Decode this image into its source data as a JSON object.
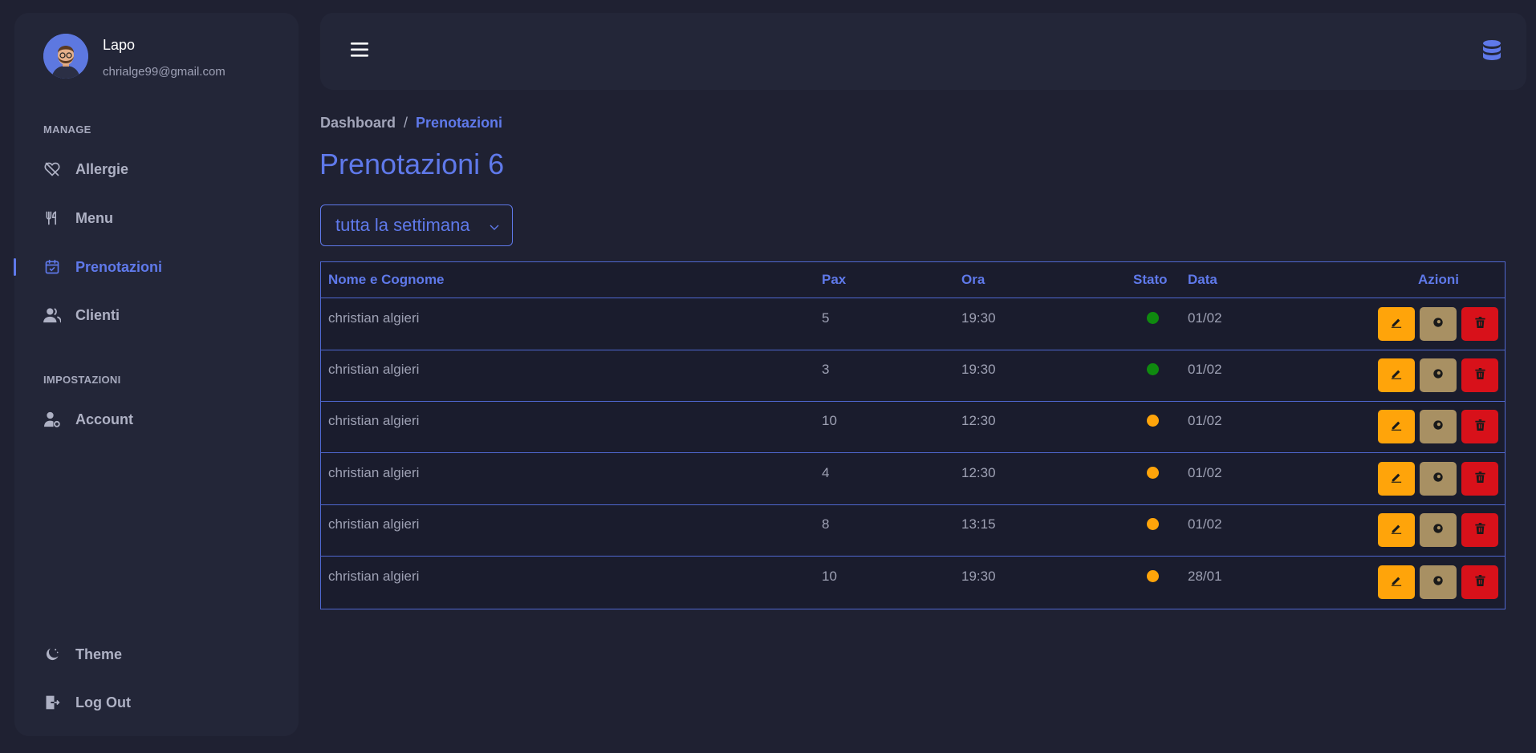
{
  "user": {
    "name": "Lapo",
    "email": "chrialge99@gmail.com"
  },
  "sidebar": {
    "manage_label": "MANAGE",
    "settings_label": "IMPOSTAZIONI",
    "items": [
      {
        "label": "Allergie",
        "icon": "heart-off-icon"
      },
      {
        "label": "Menu",
        "icon": "fork-knife-icon"
      },
      {
        "label": "Prenotazioni",
        "icon": "calendar-check-icon",
        "active": true
      },
      {
        "label": "Clienti",
        "icon": "users-icon"
      },
      {
        "label": "Account",
        "icon": "user-cog-icon"
      },
      {
        "label": "Theme",
        "icon": "moon-icon"
      },
      {
        "label": "Log Out",
        "icon": "logout-icon"
      }
    ]
  },
  "header": {
    "menu_icon": "hamburger-icon",
    "right_icon": "database-icon"
  },
  "breadcrumb": {
    "home": "Dashboard",
    "separator": "/",
    "current": "Prenotazioni"
  },
  "page": {
    "title": "Prenotazioni 6"
  },
  "filter": {
    "value": "tutta la settimana"
  },
  "table": {
    "headers": {
      "name": "Nome e Cognome",
      "pax": "Pax",
      "time": "Ora",
      "status": "Stato",
      "date": "Data",
      "actions": "Azioni"
    },
    "rows": [
      {
        "name": "christian algieri",
        "pax": "5",
        "time": "19:30",
        "status": "green",
        "date": "01/02"
      },
      {
        "name": "christian algieri",
        "pax": "3",
        "time": "19:30",
        "status": "green",
        "date": "01/02"
      },
      {
        "name": "christian algieri",
        "pax": "10",
        "time": "12:30",
        "status": "orange",
        "date": "01/02"
      },
      {
        "name": "christian algieri",
        "pax": "4",
        "time": "12:30",
        "status": "orange",
        "date": "01/02"
      },
      {
        "name": "christian algieri",
        "pax": "8",
        "time": "13:15",
        "status": "orange",
        "date": "01/02"
      },
      {
        "name": "christian algieri",
        "pax": "10",
        "time": "19:30",
        "status": "orange",
        "date": "28/01"
      }
    ]
  },
  "colors": {
    "accent": "#5f79ea",
    "status_green": "#0f8a0f",
    "status_orange": "#ffa40a",
    "btn_edit": "#ffa40a",
    "btn_view": "#a89063",
    "btn_delete": "#d8111a"
  }
}
